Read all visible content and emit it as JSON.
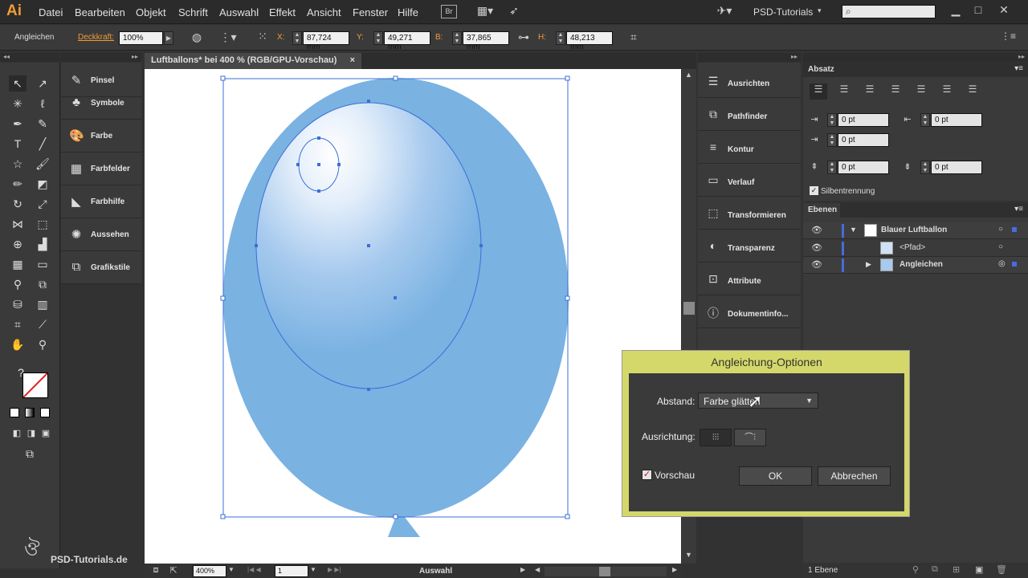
{
  "app": {
    "logo": "Ai"
  },
  "menu": [
    "Datei",
    "Bearbeiten",
    "Objekt",
    "Schrift",
    "Auswahl",
    "Effekt",
    "Ansicht",
    "Fenster",
    "Hilfe"
  ],
  "menu_br": "Br",
  "workspace": "PSD-Tutorials",
  "control": {
    "selection_label": "Angleichen",
    "opacity_label": "Deckkraft:",
    "opacity_value": "100%",
    "x_label": "X:",
    "x_value": "87,724 mm",
    "y_label": "Y:",
    "y_value": "49,271 mm",
    "b_label": "B:",
    "b_value": "37,865 mm",
    "h_label": "H:",
    "h_value": "48,213 mm"
  },
  "document": {
    "tab_title": "Luftballons* bei 400 % (RGB/GPU-Vorschau)",
    "close": "×"
  },
  "left_panels": [
    "Pinsel",
    "Symbole",
    "Farbe",
    "Farbfelder",
    "Farbhilfe",
    "Aussehen",
    "Grafikstile"
  ],
  "mid_panels": [
    "Ausrichten",
    "Pathfinder",
    "Kontur",
    "Verlauf",
    "Transformieren",
    "Transparenz",
    "Attribute",
    "Dokumentinfo..."
  ],
  "absatz": {
    "title": "Absatz",
    "fields": [
      "0 pt",
      "0 pt",
      "0 pt",
      "0 pt",
      "0 pt"
    ],
    "hyphenation": "Silbentrennung"
  },
  "ebenen": {
    "title": "Ebenen",
    "layers": [
      {
        "name": "Blauer Luftballon"
      },
      {
        "name": "<Pfad>"
      },
      {
        "name": "Angleichen"
      }
    ],
    "footer": "1 Ebene"
  },
  "status": {
    "zoom": "400%",
    "page": "1",
    "tool": "Auswahl"
  },
  "dialog": {
    "title": "Angleichung-Optionen",
    "spacing_label": "Abstand:",
    "spacing_value": "Farbe glätten",
    "orientation_label": "Ausrichtung:",
    "preview_label": "Vorschau",
    "ok_label": "OK",
    "cancel_label": "Abbrechen"
  },
  "watermark": "PSD-Tutorials.de",
  "colors": {
    "balloon": "#7ab2e2",
    "dialog_frame": "#d4d86a",
    "accent": "#f19c33"
  }
}
